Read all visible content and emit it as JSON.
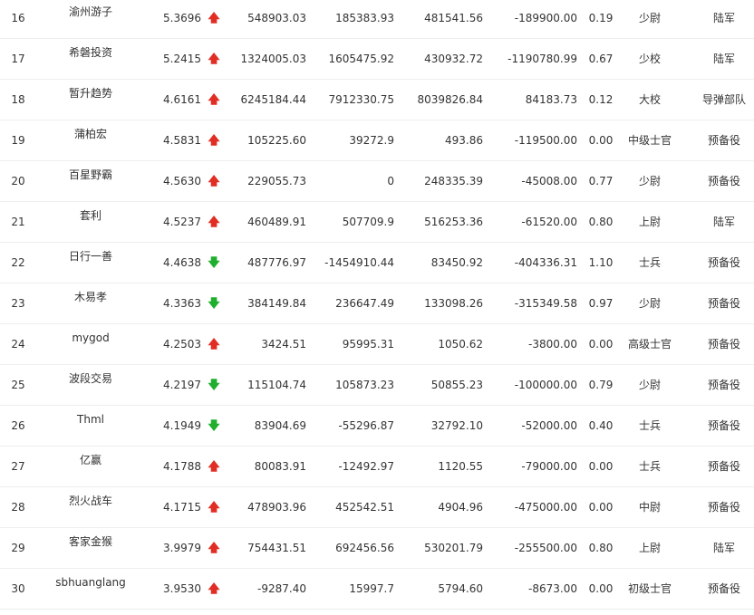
{
  "colors": {
    "up": "#e02e24",
    "down": "#1fae2d",
    "text": "#333333",
    "divider": "#eeeeee"
  },
  "rows": [
    {
      "rank": "16",
      "name": "渝州游子",
      "score": "5.3696",
      "trend": "up",
      "v1": "548903.03",
      "v2": "185383.93",
      "v3": "481541.56",
      "v4": "-189900.00",
      "ratio": "0.19",
      "title": "少尉",
      "branch": "陆军"
    },
    {
      "rank": "17",
      "name": "希磐投资",
      "score": "5.2415",
      "trend": "up",
      "v1": "1324005.03",
      "v2": "1605475.92",
      "v3": "430932.72",
      "v4": "-1190780.99",
      "ratio": "0.67",
      "title": "少校",
      "branch": "陆军"
    },
    {
      "rank": "18",
      "name": "暂升趋势",
      "score": "4.6161",
      "trend": "up",
      "v1": "6245184.44",
      "v2": "7912330.75",
      "v3": "8039826.84",
      "v4": "84183.73",
      "ratio": "0.12",
      "title": "大校",
      "branch": "导弹部队"
    },
    {
      "rank": "19",
      "name": "蒲柏宏",
      "score": "4.5831",
      "trend": "up",
      "v1": "105225.60",
      "v2": "39272.9",
      "v3": "493.86",
      "v4": "-119500.00",
      "ratio": "0.00",
      "title": "中级士官",
      "branch": "预备役"
    },
    {
      "rank": "20",
      "name": "百星野霸",
      "score": "4.5630",
      "trend": "up",
      "v1": "229055.73",
      "v2": "0",
      "v3": "248335.39",
      "v4": "-45008.00",
      "ratio": "0.77",
      "title": "少尉",
      "branch": "预备役"
    },
    {
      "rank": "21",
      "name": "套利",
      "score": "4.5237",
      "trend": "up",
      "v1": "460489.91",
      "v2": "507709.9",
      "v3": "516253.36",
      "v4": "-61520.00",
      "ratio": "0.80",
      "title": "上尉",
      "branch": "陆军"
    },
    {
      "rank": "22",
      "name": "日行一善",
      "score": "4.4638",
      "trend": "down",
      "v1": "487776.97",
      "v2": "-1454910.44",
      "v3": "83450.92",
      "v4": "-404336.31",
      "ratio": "1.10",
      "title": "士兵",
      "branch": "预备役"
    },
    {
      "rank": "23",
      "name": "木易孝",
      "score": "4.3363",
      "trend": "down",
      "v1": "384149.84",
      "v2": "236647.49",
      "v3": "133098.26",
      "v4": "-315349.58",
      "ratio": "0.97",
      "title": "少尉",
      "branch": "预备役"
    },
    {
      "rank": "24",
      "name": "mygod",
      "score": "4.2503",
      "trend": "up",
      "v1": "3424.51",
      "v2": "95995.31",
      "v3": "1050.62",
      "v4": "-3800.00",
      "ratio": "0.00",
      "title": "高级士官",
      "branch": "预备役"
    },
    {
      "rank": "25",
      "name": "波段交易",
      "score": "4.2197",
      "trend": "down",
      "v1": "115104.74",
      "v2": "105873.23",
      "v3": "50855.23",
      "v4": "-100000.00",
      "ratio": "0.79",
      "title": "少尉",
      "branch": "预备役"
    },
    {
      "rank": "26",
      "name": "Thml",
      "score": "4.1949",
      "trend": "down",
      "v1": "83904.69",
      "v2": "-55296.87",
      "v3": "32792.10",
      "v4": "-52000.00",
      "ratio": "0.40",
      "title": "士兵",
      "branch": "预备役"
    },
    {
      "rank": "27",
      "name": "亿赢",
      "score": "4.1788",
      "trend": "up",
      "v1": "80083.91",
      "v2": "-12492.97",
      "v3": "1120.55",
      "v4": "-79000.00",
      "ratio": "0.00",
      "title": "士兵",
      "branch": "预备役"
    },
    {
      "rank": "28",
      "name": "烈火战车",
      "score": "4.1715",
      "trend": "up",
      "v1": "478903.96",
      "v2": "452542.51",
      "v3": "4904.96",
      "v4": "-475000.00",
      "ratio": "0.00",
      "title": "中尉",
      "branch": "预备役"
    },
    {
      "rank": "29",
      "name": "客家金猴",
      "score": "3.9979",
      "trend": "up",
      "v1": "754431.51",
      "v2": "692456.56",
      "v3": "530201.79",
      "v4": "-255500.00",
      "ratio": "0.80",
      "title": "上尉",
      "branch": "陆军"
    },
    {
      "rank": "30",
      "name": "sbhuanglang",
      "score": "3.9530",
      "trend": "up",
      "v1": "-9287.40",
      "v2": "15997.7",
      "v3": "5794.60",
      "v4": "-8673.00",
      "ratio": "0.00",
      "title": "初级士官",
      "branch": "预备役"
    }
  ]
}
